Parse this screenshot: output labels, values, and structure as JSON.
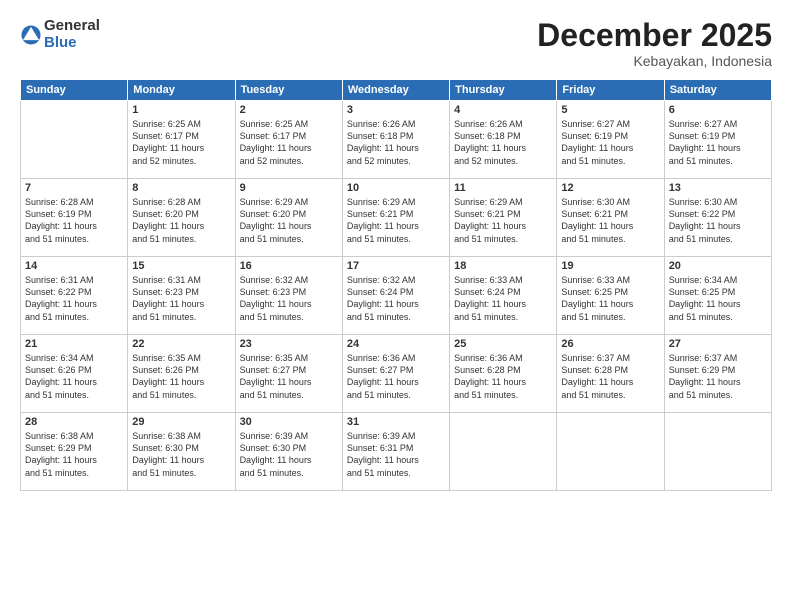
{
  "logo": {
    "general": "General",
    "blue": "Blue"
  },
  "title": "December 2025",
  "location": "Kebayakan, Indonesia",
  "days_header": [
    "Sunday",
    "Monday",
    "Tuesday",
    "Wednesday",
    "Thursday",
    "Friday",
    "Saturday"
  ],
  "weeks": [
    [
      {
        "num": "",
        "info": ""
      },
      {
        "num": "1",
        "info": "Sunrise: 6:25 AM\nSunset: 6:17 PM\nDaylight: 11 hours\nand 52 minutes."
      },
      {
        "num": "2",
        "info": "Sunrise: 6:25 AM\nSunset: 6:17 PM\nDaylight: 11 hours\nand 52 minutes."
      },
      {
        "num": "3",
        "info": "Sunrise: 6:26 AM\nSunset: 6:18 PM\nDaylight: 11 hours\nand 52 minutes."
      },
      {
        "num": "4",
        "info": "Sunrise: 6:26 AM\nSunset: 6:18 PM\nDaylight: 11 hours\nand 52 minutes."
      },
      {
        "num": "5",
        "info": "Sunrise: 6:27 AM\nSunset: 6:19 PM\nDaylight: 11 hours\nand 51 minutes."
      },
      {
        "num": "6",
        "info": "Sunrise: 6:27 AM\nSunset: 6:19 PM\nDaylight: 11 hours\nand 51 minutes."
      }
    ],
    [
      {
        "num": "7",
        "info": "Sunrise: 6:28 AM\nSunset: 6:19 PM\nDaylight: 11 hours\nand 51 minutes."
      },
      {
        "num": "8",
        "info": "Sunrise: 6:28 AM\nSunset: 6:20 PM\nDaylight: 11 hours\nand 51 minutes."
      },
      {
        "num": "9",
        "info": "Sunrise: 6:29 AM\nSunset: 6:20 PM\nDaylight: 11 hours\nand 51 minutes."
      },
      {
        "num": "10",
        "info": "Sunrise: 6:29 AM\nSunset: 6:21 PM\nDaylight: 11 hours\nand 51 minutes."
      },
      {
        "num": "11",
        "info": "Sunrise: 6:29 AM\nSunset: 6:21 PM\nDaylight: 11 hours\nand 51 minutes."
      },
      {
        "num": "12",
        "info": "Sunrise: 6:30 AM\nSunset: 6:21 PM\nDaylight: 11 hours\nand 51 minutes."
      },
      {
        "num": "13",
        "info": "Sunrise: 6:30 AM\nSunset: 6:22 PM\nDaylight: 11 hours\nand 51 minutes."
      }
    ],
    [
      {
        "num": "14",
        "info": "Sunrise: 6:31 AM\nSunset: 6:22 PM\nDaylight: 11 hours\nand 51 minutes."
      },
      {
        "num": "15",
        "info": "Sunrise: 6:31 AM\nSunset: 6:23 PM\nDaylight: 11 hours\nand 51 minutes."
      },
      {
        "num": "16",
        "info": "Sunrise: 6:32 AM\nSunset: 6:23 PM\nDaylight: 11 hours\nand 51 minutes."
      },
      {
        "num": "17",
        "info": "Sunrise: 6:32 AM\nSunset: 6:24 PM\nDaylight: 11 hours\nand 51 minutes."
      },
      {
        "num": "18",
        "info": "Sunrise: 6:33 AM\nSunset: 6:24 PM\nDaylight: 11 hours\nand 51 minutes."
      },
      {
        "num": "19",
        "info": "Sunrise: 6:33 AM\nSunset: 6:25 PM\nDaylight: 11 hours\nand 51 minutes."
      },
      {
        "num": "20",
        "info": "Sunrise: 6:34 AM\nSunset: 6:25 PM\nDaylight: 11 hours\nand 51 minutes."
      }
    ],
    [
      {
        "num": "21",
        "info": "Sunrise: 6:34 AM\nSunset: 6:26 PM\nDaylight: 11 hours\nand 51 minutes."
      },
      {
        "num": "22",
        "info": "Sunrise: 6:35 AM\nSunset: 6:26 PM\nDaylight: 11 hours\nand 51 minutes."
      },
      {
        "num": "23",
        "info": "Sunrise: 6:35 AM\nSunset: 6:27 PM\nDaylight: 11 hours\nand 51 minutes."
      },
      {
        "num": "24",
        "info": "Sunrise: 6:36 AM\nSunset: 6:27 PM\nDaylight: 11 hours\nand 51 minutes."
      },
      {
        "num": "25",
        "info": "Sunrise: 6:36 AM\nSunset: 6:28 PM\nDaylight: 11 hours\nand 51 minutes."
      },
      {
        "num": "26",
        "info": "Sunrise: 6:37 AM\nSunset: 6:28 PM\nDaylight: 11 hours\nand 51 minutes."
      },
      {
        "num": "27",
        "info": "Sunrise: 6:37 AM\nSunset: 6:29 PM\nDaylight: 11 hours\nand 51 minutes."
      }
    ],
    [
      {
        "num": "28",
        "info": "Sunrise: 6:38 AM\nSunset: 6:29 PM\nDaylight: 11 hours\nand 51 minutes."
      },
      {
        "num": "29",
        "info": "Sunrise: 6:38 AM\nSunset: 6:30 PM\nDaylight: 11 hours\nand 51 minutes."
      },
      {
        "num": "30",
        "info": "Sunrise: 6:39 AM\nSunset: 6:30 PM\nDaylight: 11 hours\nand 51 minutes."
      },
      {
        "num": "31",
        "info": "Sunrise: 6:39 AM\nSunset: 6:31 PM\nDaylight: 11 hours\nand 51 minutes."
      },
      {
        "num": "",
        "info": ""
      },
      {
        "num": "",
        "info": ""
      },
      {
        "num": "",
        "info": ""
      }
    ]
  ]
}
